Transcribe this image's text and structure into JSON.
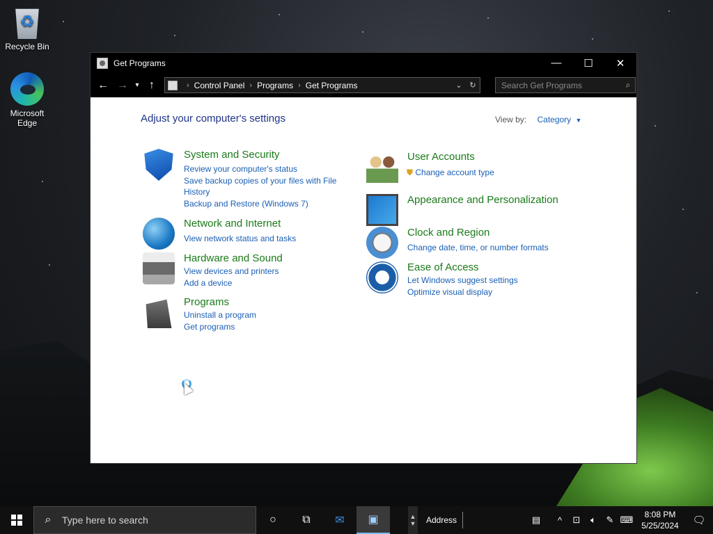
{
  "desktop": {
    "icons": [
      {
        "label": "Recycle Bin"
      },
      {
        "label": "Microsoft\nEdge"
      }
    ]
  },
  "window": {
    "title": "Get Programs",
    "address": {
      "crumbs": [
        "Control Panel",
        "Programs",
        "Get Programs"
      ]
    },
    "search_placeholder": "Search Get Programs"
  },
  "content": {
    "heading": "Adjust your computer's settings",
    "view_by_label": "View by:",
    "view_by_value": "Category",
    "categories": [
      {
        "title": "System and Security",
        "links": [
          "Review your computer's status",
          "Save backup copies of your files with File History",
          "Backup and Restore (Windows 7)"
        ]
      },
      {
        "title": "Network and Internet",
        "links": [
          "View network status and tasks"
        ]
      },
      {
        "title": "Hardware and Sound",
        "links": [
          "View devices and printers",
          "Add a device"
        ]
      },
      {
        "title": "Programs",
        "links": [
          "Uninstall a program",
          "Get programs"
        ]
      },
      {
        "title": "User Accounts",
        "links": [
          "Change account type"
        ]
      },
      {
        "title": "Appearance and Personalization",
        "links": []
      },
      {
        "title": "Clock and Region",
        "links": [
          "Change date, time, or number formats"
        ]
      },
      {
        "title": "Ease of Access",
        "links": [
          "Let Windows suggest settings",
          "Optimize visual display"
        ]
      }
    ]
  },
  "taskbar": {
    "search_placeholder": "Type here to search",
    "address_label": "Address",
    "time": "8:08 PM",
    "date": "5/25/2024"
  }
}
